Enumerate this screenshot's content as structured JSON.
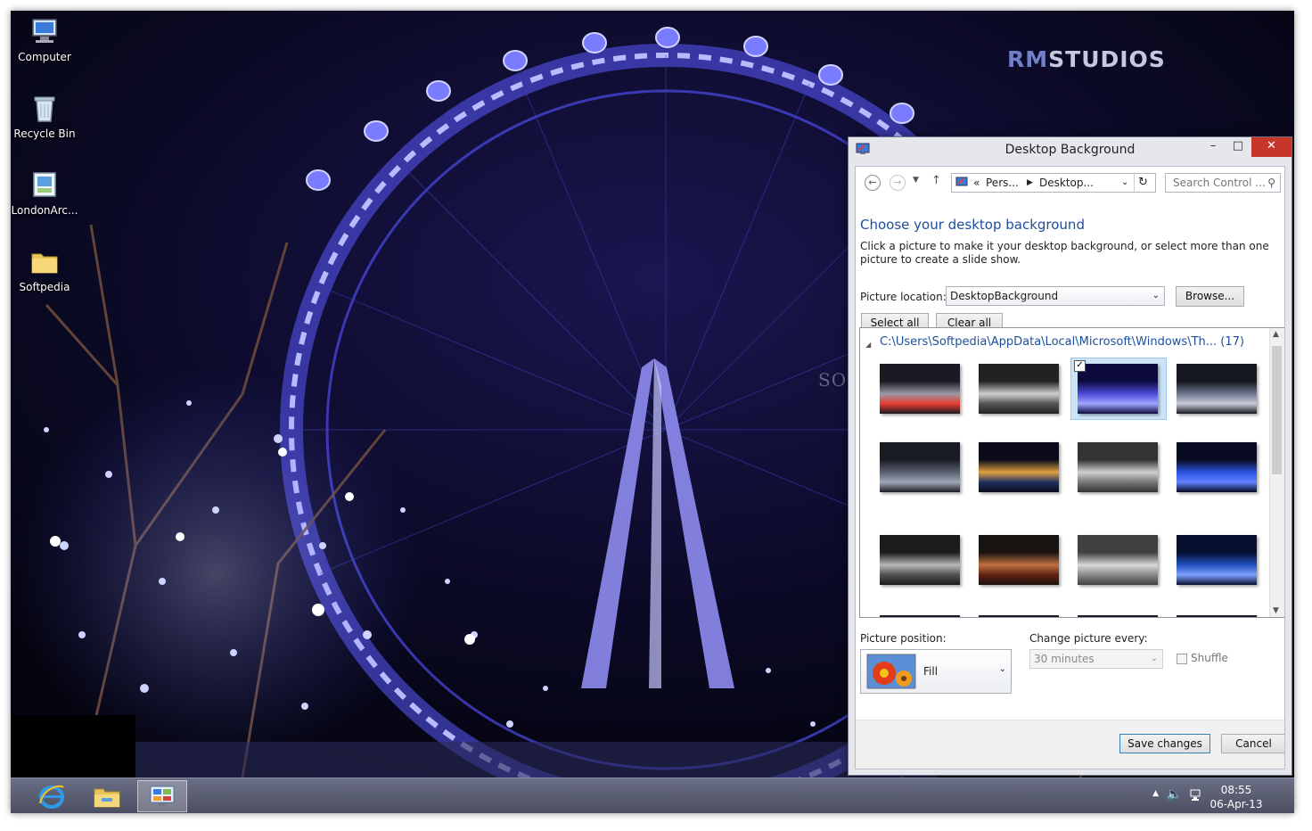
{
  "desktop": {
    "icons": [
      {
        "label": "Computer",
        "icon": "computer-icon"
      },
      {
        "label": "Recycle Bin",
        "icon": "recycle-bin-icon"
      },
      {
        "label": "LondonArc...",
        "icon": "theme-file-icon"
      },
      {
        "label": "Softpedia",
        "icon": "folder-icon"
      }
    ],
    "brand_a": "RM",
    "brand_b": "STUDIOS",
    "watermark": "SOFTPEDIA"
  },
  "window": {
    "title": "Desktop Background",
    "controls": {
      "minimize": "–",
      "maximize": "□",
      "close": "✕"
    },
    "address": {
      "root": "«",
      "crumb1": "Pers...",
      "crumb2": "Desktop..."
    },
    "search_placeholder": "Search Control ...",
    "heading": "Choose your desktop background",
    "description": "Click a picture to make it your desktop background, or select more than one picture to create a slide show.",
    "picture_location_label": "Picture location:",
    "picture_location_value": "DesktopBackground",
    "browse_label": "Browse...",
    "select_all_label": "Select all",
    "clear_all_label": "Clear all",
    "group_header": "C:\\Users\\Softpedia\\AppData\\Local\\Microsoft\\Windows\\Th... (17)",
    "thumbnails": [
      {
        "name": "thumb-tower-bridge",
        "selected": false,
        "colors": [
          "#1a1a22",
          "#9a9aa6",
          "#e83b2e"
        ]
      },
      {
        "name": "thumb-big-ben",
        "selected": false,
        "colors": [
          "#222",
          "#cfcfcf",
          "#555"
        ]
      },
      {
        "name": "thumb-london-eye",
        "selected": true,
        "colors": [
          "#0c0a3c",
          "#4b4bd8",
          "#9fa6ff"
        ]
      },
      {
        "name": "thumb-bridge-night",
        "selected": false,
        "colors": [
          "#15171f",
          "#6f7890",
          "#c8cbd8"
        ]
      },
      {
        "name": "thumb-canary-wharf",
        "selected": false,
        "colors": [
          "#1a1c24",
          "#5a6070",
          "#a0a8b8"
        ]
      },
      {
        "name": "thumb-river-lights",
        "selected": false,
        "colors": [
          "#0a0a1a",
          "#e0a040",
          "#203060"
        ]
      },
      {
        "name": "thumb-admiralty-arch",
        "selected": false,
        "colors": [
          "#333",
          "#d0d0d0",
          "#777"
        ]
      },
      {
        "name": "thumb-blue-eye",
        "selected": false,
        "colors": [
          "#070a20",
          "#2a55e0",
          "#6080ff"
        ]
      },
      {
        "name": "thumb-buckingham",
        "selected": false,
        "colors": [
          "#1c1c1c",
          "#b8b8b8",
          "#505050"
        ]
      },
      {
        "name": "thumb-city-street",
        "selected": false,
        "colors": [
          "#1a1410",
          "#c07040",
          "#602010"
        ]
      },
      {
        "name": "thumb-thames-bw",
        "selected": false,
        "colors": [
          "#404040",
          "#d8d8d8",
          "#888"
        ]
      },
      {
        "name": "thumb-st-pauls",
        "selected": false,
        "colors": [
          "#081030",
          "#2050c0",
          "#80a0ff"
        ]
      }
    ],
    "picture_position_label": "Picture position:",
    "picture_position_value": "Fill",
    "change_every_label": "Change picture every:",
    "change_every_value": "30 minutes",
    "shuffle_label": "Shuffle",
    "save_label": "Save changes",
    "cancel_label": "Cancel"
  },
  "taskbar": {
    "clock_time": "08:55",
    "clock_date": "06-Apr-13"
  }
}
